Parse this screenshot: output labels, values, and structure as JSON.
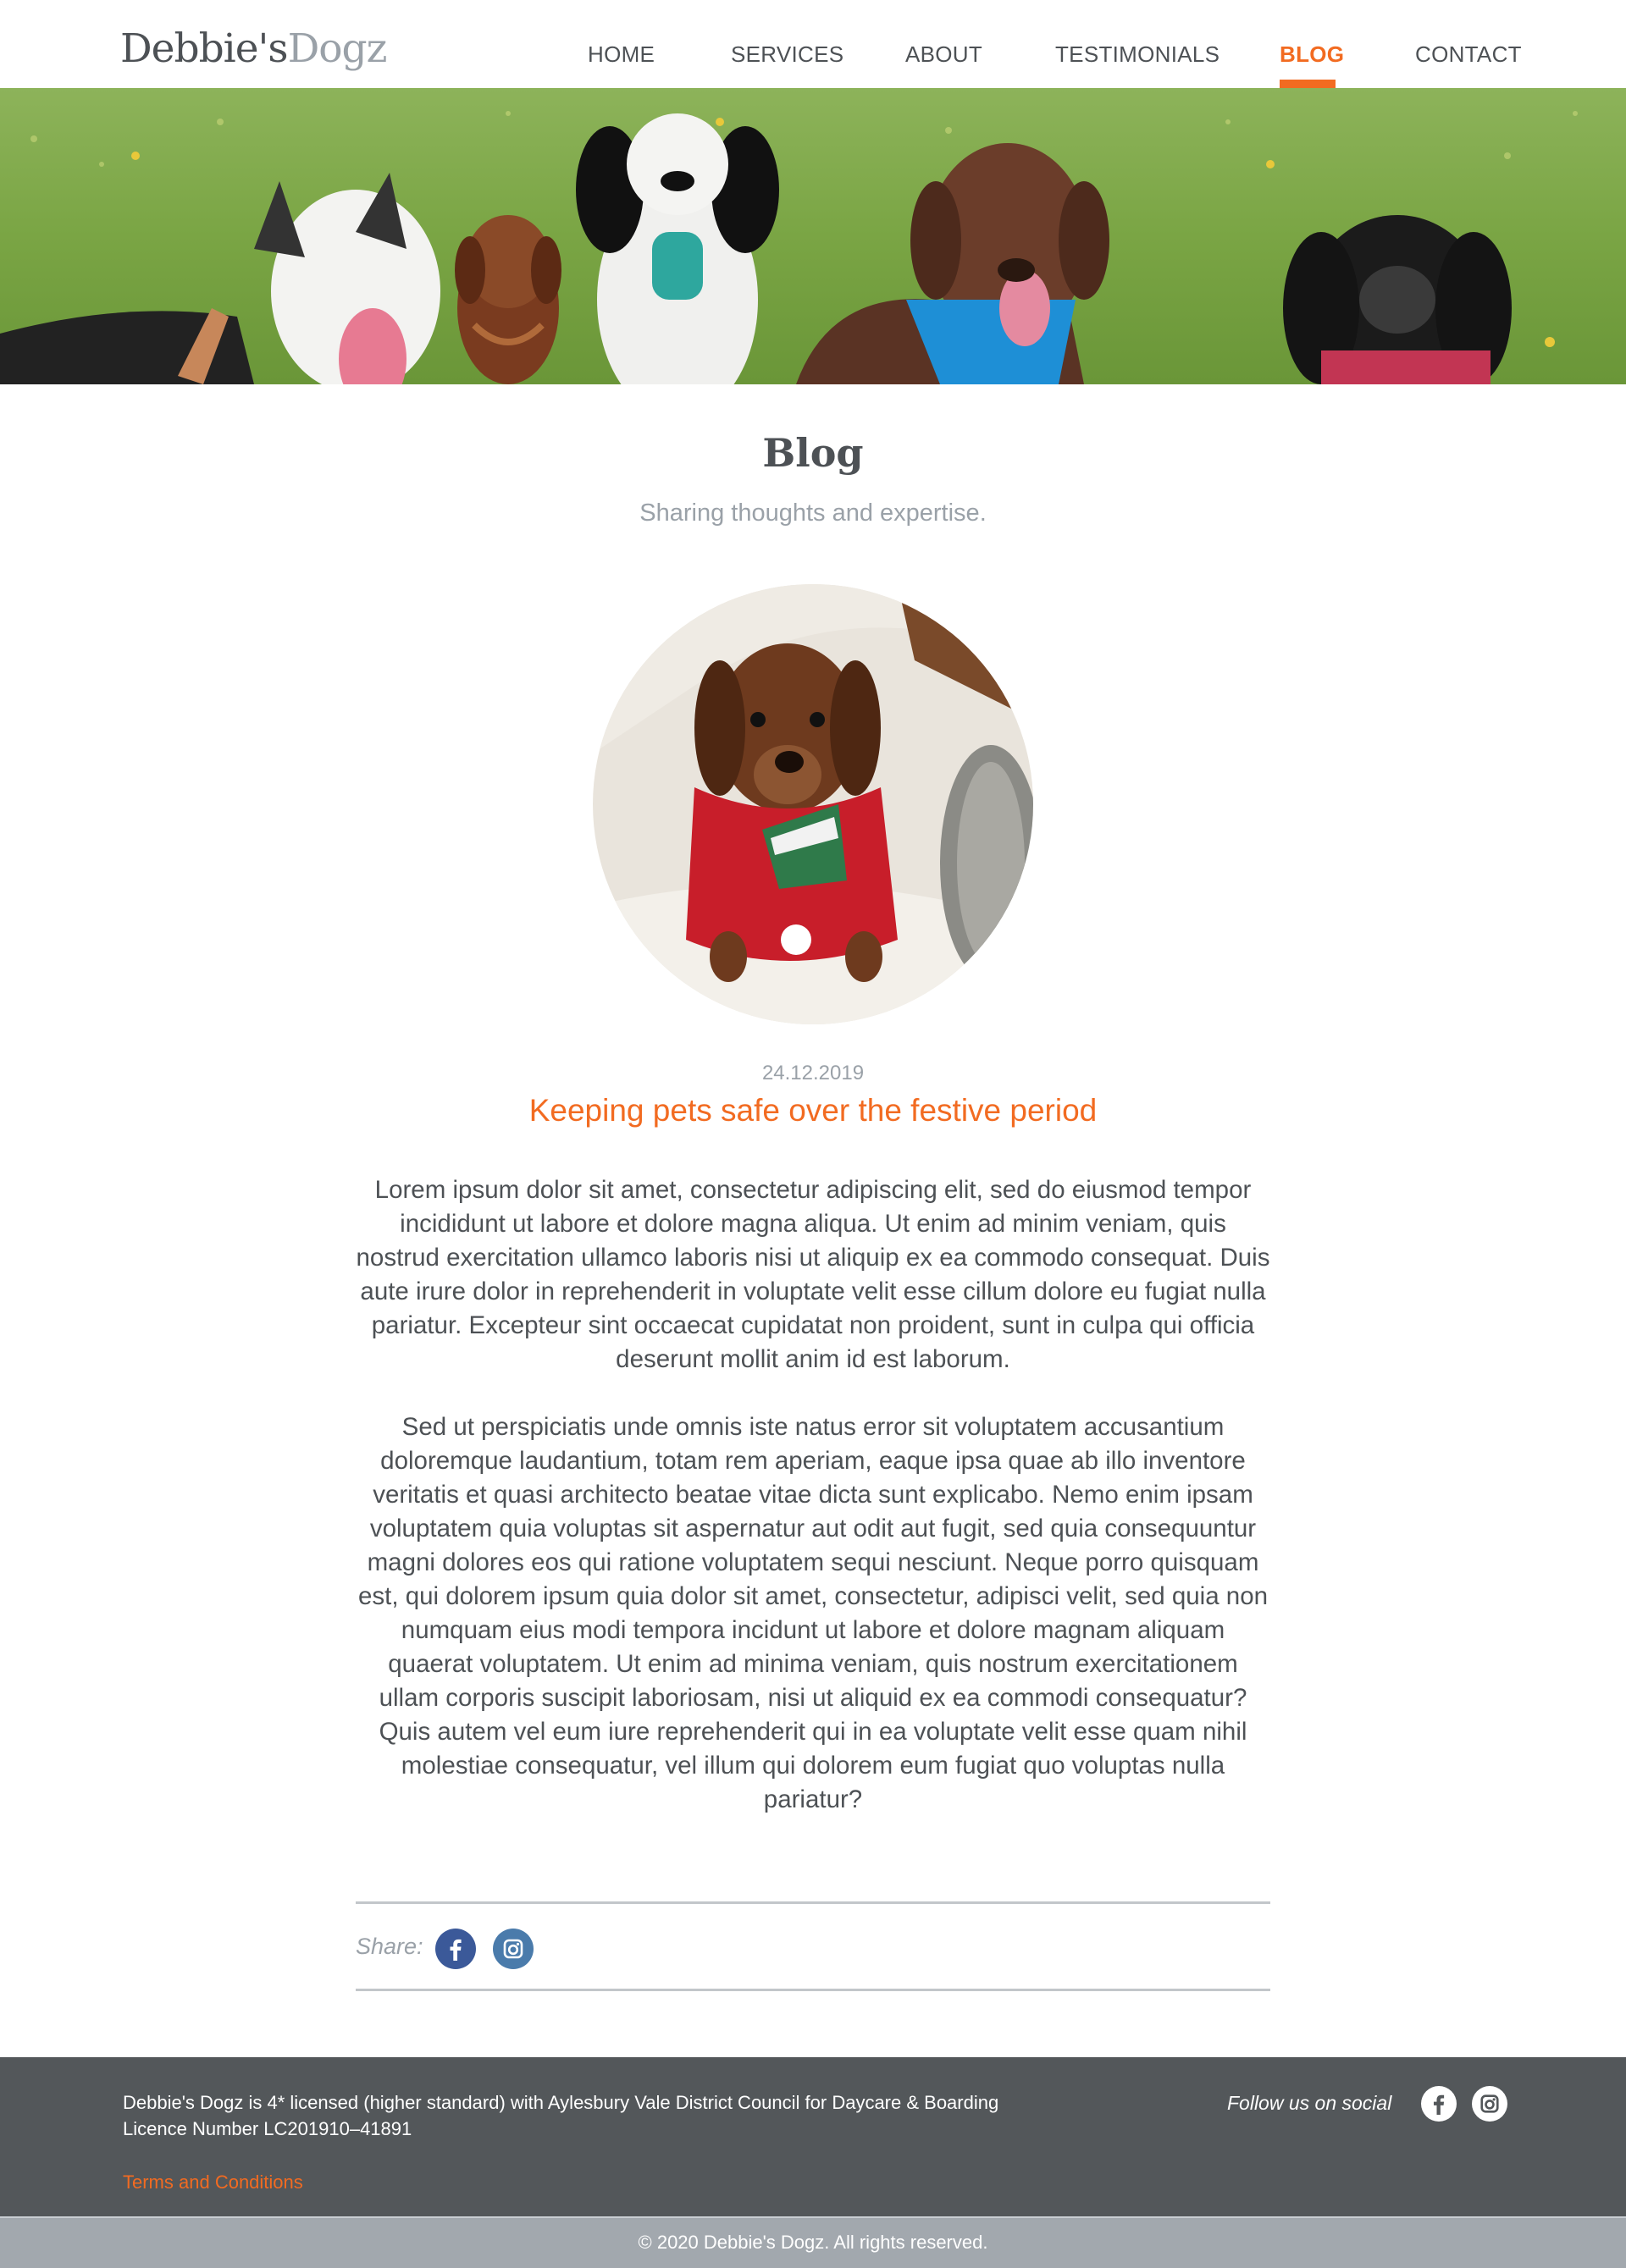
{
  "brand": {
    "name_primary": "Debbie's",
    "name_secondary": "Dogz"
  },
  "nav": {
    "items": [
      {
        "label": "HOME",
        "active": false
      },
      {
        "label": "SERVICES",
        "active": false
      },
      {
        "label": "ABOUT",
        "active": false
      },
      {
        "label": "TESTIMONIALS",
        "active": false
      },
      {
        "label": "BLOG",
        "active": true
      },
      {
        "label": "CONTACT",
        "active": false
      }
    ]
  },
  "page": {
    "title": "Blog",
    "subtitle": "Sharing thoughts and expertise."
  },
  "post": {
    "date": "24.12.2019",
    "title": "Keeping pets safe over the festive period",
    "paragraphs": [
      "Lorem ipsum dolor sit amet, consectetur adipiscing elit, sed do eiusmod tempor incididunt ut labore et dolore magna aliqua. Ut enim ad minim veniam, quis nostrud exercitation ullamco laboris nisi ut aliquip ex ea commodo consequat. Duis aute irure dolor in reprehenderit in voluptate velit esse cillum dolore eu fugiat nulla pariatur. Excepteur sint occaecat cupidatat non proident, sunt in culpa qui officia deserunt mollit anim id est laborum.",
      "Sed ut perspiciatis unde omnis iste natus error sit voluptatem accusantium doloremque laudantium, totam rem aperiam, eaque ipsa quae ab illo inventore veritatis et quasi architecto beatae vitae dicta sunt explicabo. Nemo enim ipsam voluptatem quia voluptas sit aspernatur aut odit aut fugit, sed quia consequuntur magni dolores eos qui ratione voluptatem sequi nesciunt. Neque porro quisquam est, qui dolorem ipsum quia dolor sit amet, consectetur, adipisci velit, sed quia non numquam eius modi tempora incidunt ut labore et dolore magnam aliquam quaerat voluptatem. Ut enim ad minima veniam, quis nostrum exercitationem ullam corporis suscipit laboriosam, nisi ut aliquid ex ea commodi consequatur? Quis autem vel eum iure reprehenderit qui in ea voluptate velit esse quam nihil molestiae consequatur, vel illum qui dolorem eum fugiat quo voluptas nulla pariatur?"
    ]
  },
  "share": {
    "label": "Share:",
    "icons": [
      "facebook-icon",
      "instagram-icon"
    ]
  },
  "footer": {
    "licence_line1": "Debbie's Dogz is 4* licensed (higher standard) with Aylesbury Vale District Council for Daycare & Boarding",
    "licence_line2": "Licence Number LC201910–41891",
    "terms_link": "Terms and Conditions",
    "follow_label": "Follow us on social",
    "social_icons": [
      "facebook-icon",
      "instagram-icon"
    ],
    "copyright": "© 2020 Debbie's Dogz. All rights reserved."
  },
  "colors": {
    "accent": "#f26b21",
    "text": "#4d5155",
    "muted": "#9aa1a8",
    "footer_bg": "#53575a",
    "copyright_bg": "#a2a8ae",
    "facebook": "#3b5999",
    "instagram": "#4a7bab"
  }
}
